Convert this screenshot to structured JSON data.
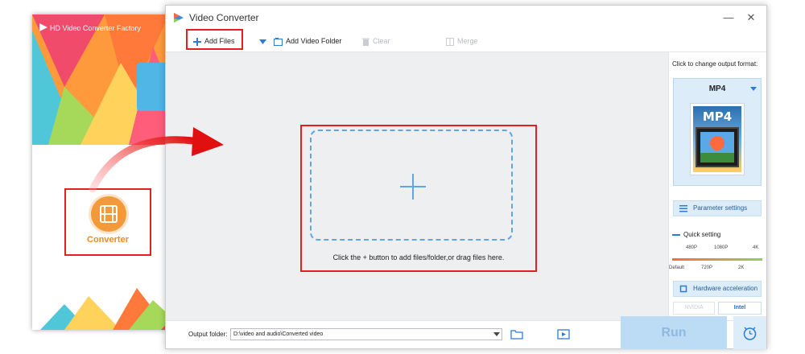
{
  "back_window": {
    "title": "HD Video Converter Factory",
    "converter_label": "Converter"
  },
  "window": {
    "title": "Video Converter",
    "minimize_glyph": "—",
    "close_glyph": "✕"
  },
  "toolbar": {
    "add_files": "Add Files",
    "add_video_folder": "Add Video Folder",
    "clear": "Clear",
    "merge": "Merge"
  },
  "drop_area": {
    "hint": "Click the + button to add files/folder,or drag files here."
  },
  "right_panel": {
    "change_format_label": "Click to change output format:",
    "format_name": "MP4",
    "format_thumb_label": "MP4",
    "parameter_settings": "Parameter settings",
    "quick_setting_label": "Quick setting",
    "quality_top_ticks": [
      "480P",
      "1080P",
      "4K"
    ],
    "quality_bottom_ticks": [
      "Default",
      "720P",
      "2K"
    ],
    "hardware_acceleration": "Hardware acceleration",
    "nvidia": "NVIDIA",
    "intel": "Intel"
  },
  "bottom_bar": {
    "output_folder_label": "Output folder:",
    "output_folder_value": "D:\\video and audio\\Converted video",
    "run_label": "Run"
  },
  "colors": {
    "highlight_red": "#e32020",
    "accent_blue": "#2e7bd6",
    "dashed_blue": "#5fa6e8",
    "converter_orange": "#f29a3a"
  }
}
